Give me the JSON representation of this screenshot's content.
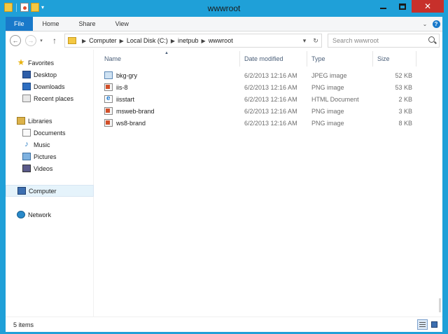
{
  "window": {
    "title": "wwwroot"
  },
  "titlebar": {
    "qat_dropdown": "▾",
    "minimize_label": "",
    "maximize_label": "",
    "close_label": "✕"
  },
  "ribbon": {
    "tabs": [
      {
        "label": "File"
      },
      {
        "label": "Home"
      },
      {
        "label": "Share"
      },
      {
        "label": "View"
      }
    ],
    "expand_label": "⌄",
    "help_label": "?"
  },
  "nav": {
    "back_label": "←",
    "forward_label": "→",
    "recent_label": "▾",
    "up_label": "↑",
    "breadcrumb": [
      "Computer",
      "Local Disk (C:)",
      "inetpub",
      "wwwroot"
    ],
    "address_dropdown": "▾",
    "refresh_label": "↻"
  },
  "search": {
    "placeholder": "Search wwwroot"
  },
  "sidebar": {
    "favorites": {
      "label": "Favorites",
      "items": [
        {
          "label": "Desktop",
          "icon": "desktop-icon"
        },
        {
          "label": "Downloads",
          "icon": "downloads-icon"
        },
        {
          "label": "Recent places",
          "icon": "recent-places-icon"
        }
      ]
    },
    "libraries": {
      "label": "Libraries",
      "items": [
        {
          "label": "Documents",
          "icon": "documents-icon"
        },
        {
          "label": "Music",
          "icon": "music-icon"
        },
        {
          "label": "Pictures",
          "icon": "pictures-icon"
        },
        {
          "label": "Videos",
          "icon": "videos-icon"
        }
      ]
    },
    "computer": {
      "label": "Computer"
    },
    "network": {
      "label": "Network"
    }
  },
  "files": {
    "columns": {
      "name": "Name",
      "date": "Date modified",
      "type": "Type",
      "size": "Size"
    },
    "sort_indicator": "▲",
    "rows": [
      {
        "name": "bkg-gry",
        "date": "6/2/2013 12:16 AM",
        "type": "JPEG image",
        "size": "52 KB",
        "icon": "jpeg-file-icon"
      },
      {
        "name": "iis-8",
        "date": "6/2/2013 12:16 AM",
        "type": "PNG image",
        "size": "53 KB",
        "icon": "png-file-icon"
      },
      {
        "name": "iisstart",
        "date": "6/2/2013 12:16 AM",
        "type": "HTML Document",
        "size": "2 KB",
        "icon": "html-file-icon"
      },
      {
        "name": "msweb-brand",
        "date": "6/2/2013 12:16 AM",
        "type": "PNG image",
        "size": "3 KB",
        "icon": "png-file-icon"
      },
      {
        "name": "ws8-brand",
        "date": "6/2/2013 12:16 AM",
        "type": "PNG image",
        "size": "8 KB",
        "icon": "png-file-icon"
      }
    ]
  },
  "status": {
    "item_count": "5 items"
  },
  "colors": {
    "frame": "#1fa0d8",
    "file_tab": "#1979ca",
    "close_button": "#c7302b",
    "selected_nav": "#e5f3fb"
  }
}
